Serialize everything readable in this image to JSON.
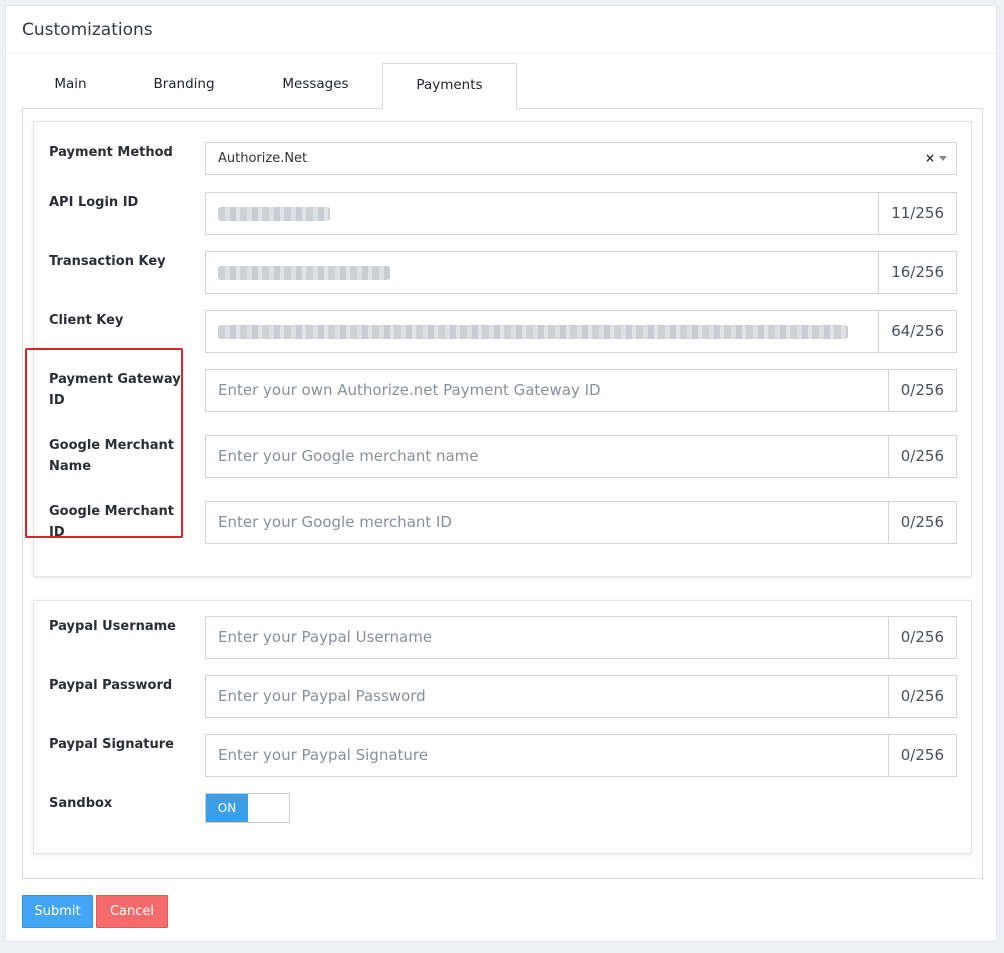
{
  "card": {
    "title": "Customizations"
  },
  "tabs": [
    {
      "label": "Main"
    },
    {
      "label": "Branding"
    },
    {
      "label": "Messages"
    },
    {
      "label": "Payments",
      "active": true
    }
  ],
  "authorize_section": {
    "payment_method": {
      "label": "Payment Method",
      "value": "Authorize.Net",
      "clear_glyph": "×"
    },
    "api_login_id": {
      "label": "API Login ID",
      "counter": "11/256"
    },
    "transaction_key": {
      "label": "Transaction Key",
      "counter": "16/256"
    },
    "client_key": {
      "label": "Client Key",
      "counter": "64/256"
    },
    "payment_gateway_id": {
      "label": "Payment Gateway ID",
      "placeholder": "Enter your own Authorize.net Payment Gateway ID",
      "counter": "0/256"
    },
    "google_merchant_name": {
      "label": "Google Merchant Name",
      "placeholder": "Enter your Google merchant name",
      "counter": "0/256"
    },
    "google_merchant_id": {
      "label": "Google Merchant ID",
      "placeholder": "Enter your Google merchant ID",
      "counter": "0/256"
    }
  },
  "paypal_section": {
    "username": {
      "label": "Paypal Username",
      "placeholder": "Enter your Paypal Username",
      "counter": "0/256"
    },
    "password": {
      "label": "Paypal Password",
      "placeholder": "Enter your Paypal Password",
      "counter": "0/256"
    },
    "signature": {
      "label": "Paypal Signature",
      "placeholder": "Enter your Paypal Signature",
      "counter": "0/256"
    },
    "sandbox": {
      "label": "Sandbox",
      "state": "ON"
    }
  },
  "actions": {
    "submit": "Submit",
    "cancel": "Cancel"
  },
  "colors": {
    "accent": "#42a5f5",
    "danger": "#f56a6a",
    "highlight": "#e0202a"
  }
}
